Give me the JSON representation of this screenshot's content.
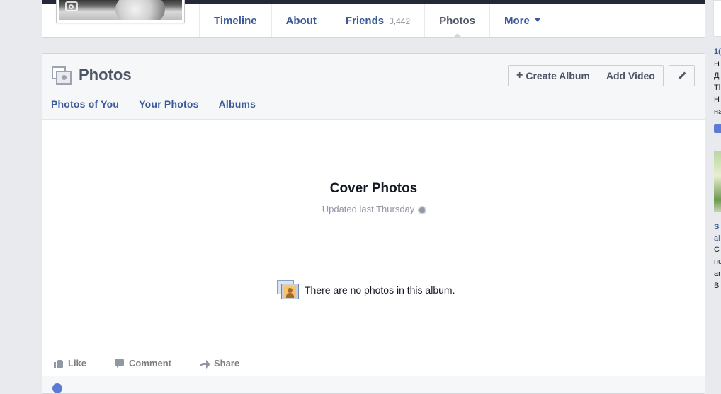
{
  "nav": {
    "tabs": [
      {
        "label": "Timeline"
      },
      {
        "label": "About"
      },
      {
        "label": "Friends",
        "count": "3,442"
      },
      {
        "label": "Photos"
      },
      {
        "label": "More"
      }
    ],
    "active_tab": "Photos"
  },
  "photos_card": {
    "title": "Photos",
    "create_album": "Create Album",
    "add_video": "Add Video",
    "sub_tabs": [
      "Photos of You",
      "Your Photos",
      "Albums"
    ],
    "album_title": "Cover Photos",
    "album_updated": "Updated last Thursday",
    "empty_message": "There are no photos in this album.",
    "actions": {
      "like": "Like",
      "comment": "Comment",
      "share": "Share"
    }
  },
  "right_column": {
    "lines_top": [
      "1(",
      "H",
      "Д",
      "Tl",
      "H",
      "на"
    ],
    "lines_bottom": [
      "S",
      "al",
      "С",
      "пс",
      "ar",
      "B"
    ]
  },
  "colors": {
    "link_blue": "#3b5998",
    "page_bg": "#e9eaed",
    "muted": "#9197a3"
  }
}
